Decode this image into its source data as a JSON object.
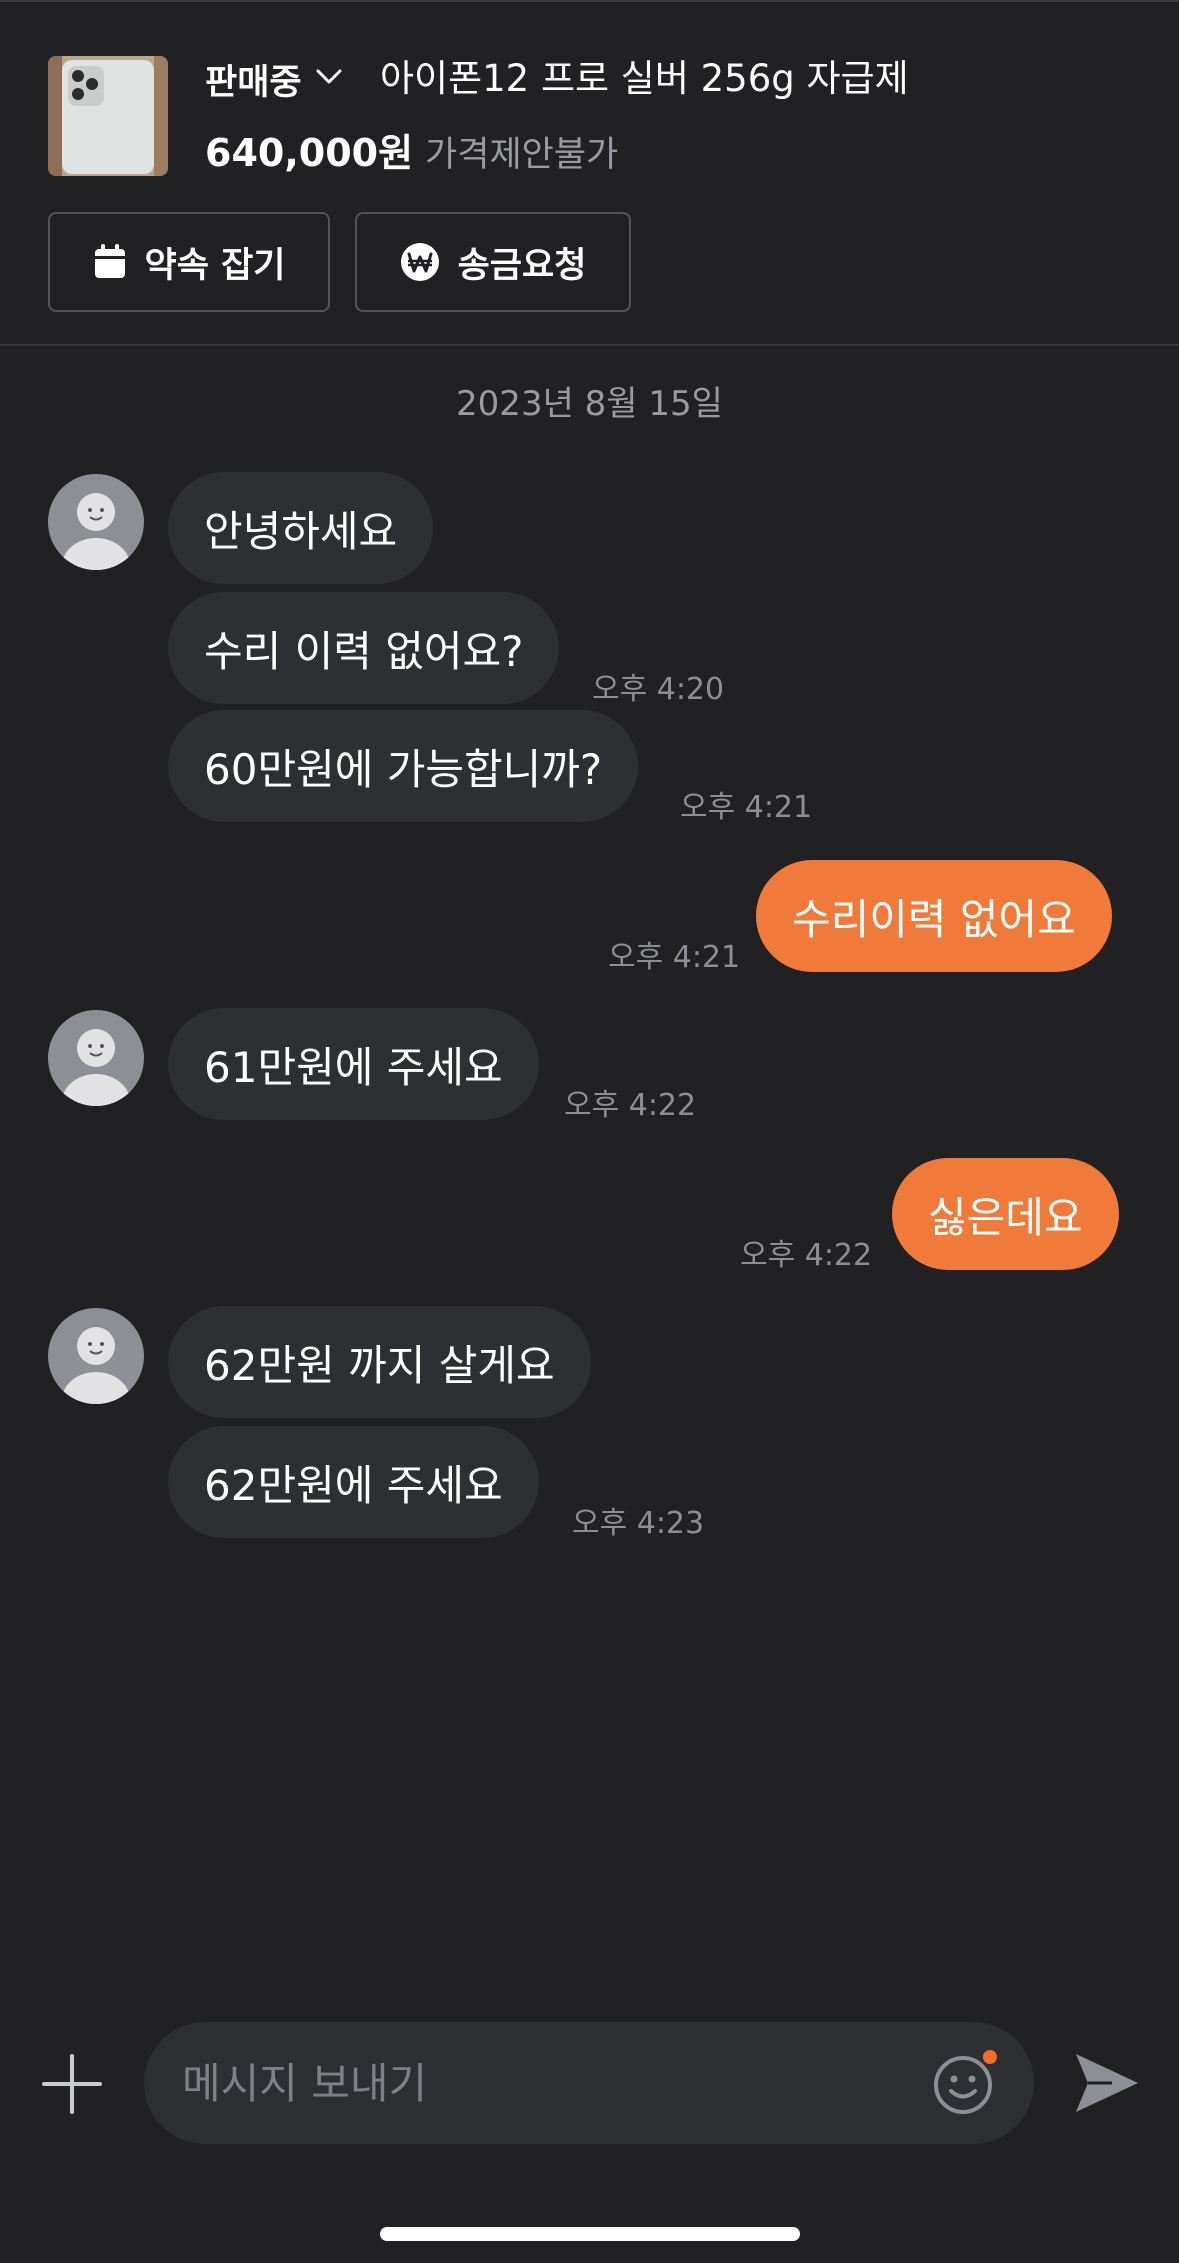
{
  "header": {
    "status_label": "판매중",
    "product_title": "아이폰12 프로 실버 256g 자급제",
    "price": "640,000원",
    "price_note": "가격제안불가",
    "buttons": {
      "appointment": "약속 잡기",
      "money_request": "송금요청"
    }
  },
  "chat": {
    "date": "2023년 8월 15일",
    "messages": [
      {
        "from": "buyer",
        "text": "안녕하세요",
        "time": ""
      },
      {
        "from": "buyer",
        "text": "수리 이력 없어요?",
        "time": "오후 4:20"
      },
      {
        "from": "buyer",
        "text": "60만원에 가능합니까?",
        "time": "오후 4:21"
      },
      {
        "from": "me",
        "text": "수리이력 없어요",
        "time": "오후 4:21"
      },
      {
        "from": "buyer",
        "text": "61만원에 주세요",
        "time": "오후 4:22"
      },
      {
        "from": "me",
        "text": "싫은데요",
        "time": "오후 4:22"
      },
      {
        "from": "buyer",
        "text": "62만원 까지 살게요",
        "time": ""
      },
      {
        "from": "buyer",
        "text": "62만원에 주세요",
        "time": "오후 4:23"
      }
    ]
  },
  "composer": {
    "placeholder": "메시지 보내기",
    "value": ""
  },
  "colors": {
    "background": "#212124",
    "incoming_bubble": "#2e2f33",
    "outgoing_bubble": "#ef7a3a",
    "muted_text": "#9a9ba0",
    "notification_dot": "#f26b2a"
  },
  "icons": {
    "status_dropdown": "chevron-down-icon",
    "appointment": "calendar-icon",
    "money_request": "won-icon",
    "attach": "plus-icon",
    "emoji": "smiley-icon",
    "send": "send-icon"
  }
}
